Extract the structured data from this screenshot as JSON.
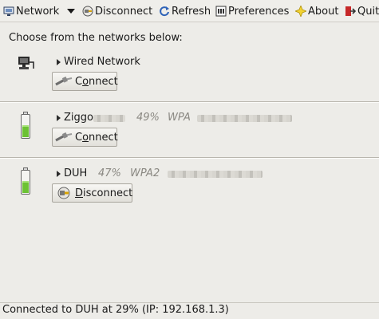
{
  "toolbar": {
    "network": "Network",
    "disconnect": "Disconnect",
    "refresh": "Refresh",
    "preferences": "Preferences",
    "about": "About",
    "quit": "Quit"
  },
  "intro": "Choose from the networks below:",
  "networks": [
    {
      "name": "Wired Network",
      "button": "Connect",
      "button_mnemonic": "o"
    },
    {
      "name": "Ziggo",
      "signal": "49%",
      "security": "WPA",
      "button": "Connect",
      "button_mnemonic": "o"
    },
    {
      "name": "DUH",
      "signal": "47%",
      "security": "WPA2",
      "button": "Disconnect",
      "button_mnemonic": "D"
    }
  ],
  "status": "Connected to DUH at 29% (IP: 192.168.1.3)",
  "colors": {
    "background": "#edece8",
    "signal_green": "#6cc234",
    "accent_blue": "#2f63b8"
  }
}
